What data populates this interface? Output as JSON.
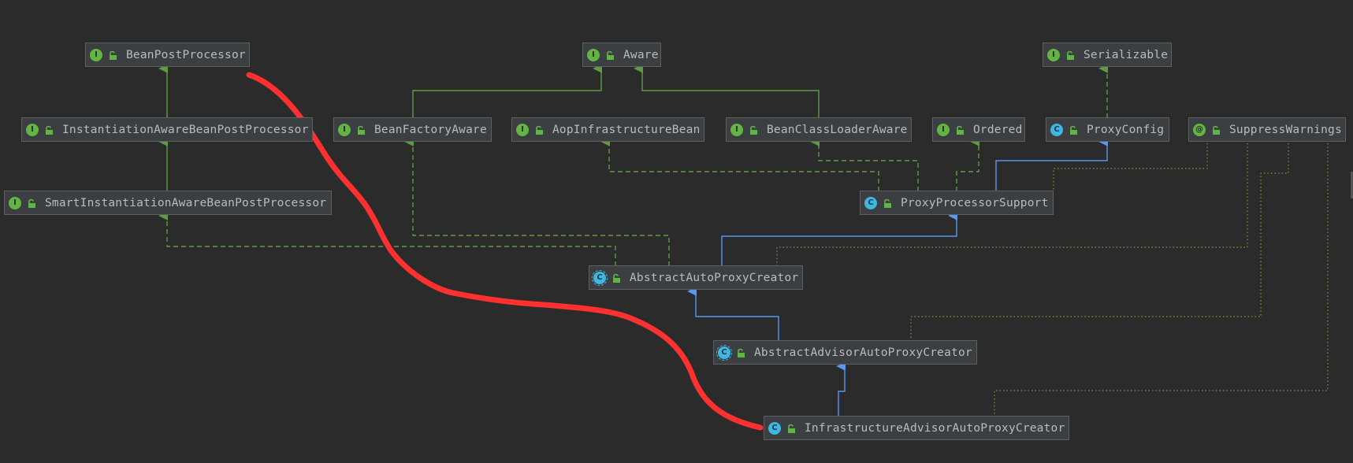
{
  "nodes": [
    {
      "id": "BeanPostProcessor",
      "label": "BeanPostProcessor",
      "kind": "I"
    },
    {
      "id": "Aware",
      "label": "Aware",
      "kind": "I"
    },
    {
      "id": "Serializable",
      "label": "Serializable",
      "kind": "I"
    },
    {
      "id": "InstantiationAwareBeanPostProcessor",
      "label": "InstantiationAwareBeanPostProcessor",
      "kind": "I"
    },
    {
      "id": "BeanFactoryAware",
      "label": "BeanFactoryAware",
      "kind": "I"
    },
    {
      "id": "AopInfrastructureBean",
      "label": "AopInfrastructureBean",
      "kind": "I"
    },
    {
      "id": "BeanClassLoaderAware",
      "label": "BeanClassLoaderAware",
      "kind": "I"
    },
    {
      "id": "Ordered",
      "label": "Ordered",
      "kind": "I"
    },
    {
      "id": "ProxyConfig",
      "label": "ProxyConfig",
      "kind": "C"
    },
    {
      "id": "SuppressWarnings",
      "label": "SuppressWarnings",
      "kind": "@"
    },
    {
      "id": "SmartInstantiationAwareBeanPostProcessor",
      "label": "SmartInstantiationAwareBeanPostProcessor",
      "kind": "I"
    },
    {
      "id": "ProxyProcessorSupport",
      "label": "ProxyProcessorSupport",
      "kind": "C"
    },
    {
      "id": "AbstractAutoProxyCreator",
      "label": "AbstractAutoProxyCreator",
      "kind": "A"
    },
    {
      "id": "AbstractAdvisorAutoProxyCreator",
      "label": "AbstractAdvisorAutoProxyCreator",
      "kind": "A"
    },
    {
      "id": "InfrastructureAdvisorAutoProxyCreator",
      "label": "InfrastructureAdvisorAutoProxyCreator",
      "kind": "C"
    }
  ],
  "edges": [
    {
      "from": "InstantiationAwareBeanPostProcessor",
      "to": "BeanPostProcessor",
      "type": "extends"
    },
    {
      "from": "SmartInstantiationAwareBeanPostProcessor",
      "to": "InstantiationAwareBeanPostProcessor",
      "type": "extends"
    },
    {
      "from": "BeanFactoryAware",
      "to": "Aware",
      "type": "extends"
    },
    {
      "from": "BeanClassLoaderAware",
      "to": "Aware",
      "type": "extends"
    },
    {
      "from": "ProxyConfig",
      "to": "Serializable",
      "type": "implements"
    },
    {
      "from": "ProxyProcessorSupport",
      "to": "ProxyConfig",
      "type": "class-extends"
    },
    {
      "from": "ProxyProcessorSupport",
      "to": "AopInfrastructureBean",
      "type": "implements"
    },
    {
      "from": "ProxyProcessorSupport",
      "to": "BeanClassLoaderAware",
      "type": "implements"
    },
    {
      "from": "ProxyProcessorSupport",
      "to": "Ordered",
      "type": "implements"
    },
    {
      "from": "AbstractAutoProxyCreator",
      "to": "ProxyProcessorSupport",
      "type": "class-extends"
    },
    {
      "from": "AbstractAutoProxyCreator",
      "to": "SmartInstantiationAwareBeanPostProcessor",
      "type": "implements"
    },
    {
      "from": "AbstractAutoProxyCreator",
      "to": "BeanFactoryAware",
      "type": "implements"
    },
    {
      "from": "AbstractAdvisorAutoProxyCreator",
      "to": "AbstractAutoProxyCreator",
      "type": "class-extends"
    },
    {
      "from": "InfrastructureAdvisorAutoProxyCreator",
      "to": "AbstractAdvisorAutoProxyCreator",
      "type": "class-extends"
    },
    {
      "from": "AbstractAutoProxyCreator",
      "to": "SuppressWarnings",
      "type": "annotated"
    },
    {
      "from": "AbstractAdvisorAutoProxyCreator",
      "to": "SuppressWarnings",
      "type": "annotated"
    },
    {
      "from": "InfrastructureAdvisorAutoProxyCreator",
      "to": "SuppressWarnings",
      "type": "annotated"
    },
    {
      "from": "ProxyProcessorSupport",
      "to": "SuppressWarnings",
      "type": "annotated"
    }
  ],
  "colors": {
    "background": "#2b2b2b",
    "extends": "#5f9a45",
    "class_extends": "#5897f2",
    "implements": "#5f9a45",
    "annotated": "#9a8a3a",
    "highlight": "#ff3333"
  },
  "icons": {
    "I": "interface-icon",
    "C": "class-icon",
    "A": "abstract-class-icon",
    "@": "annotation-icon",
    "lock": "public-access-icon"
  }
}
